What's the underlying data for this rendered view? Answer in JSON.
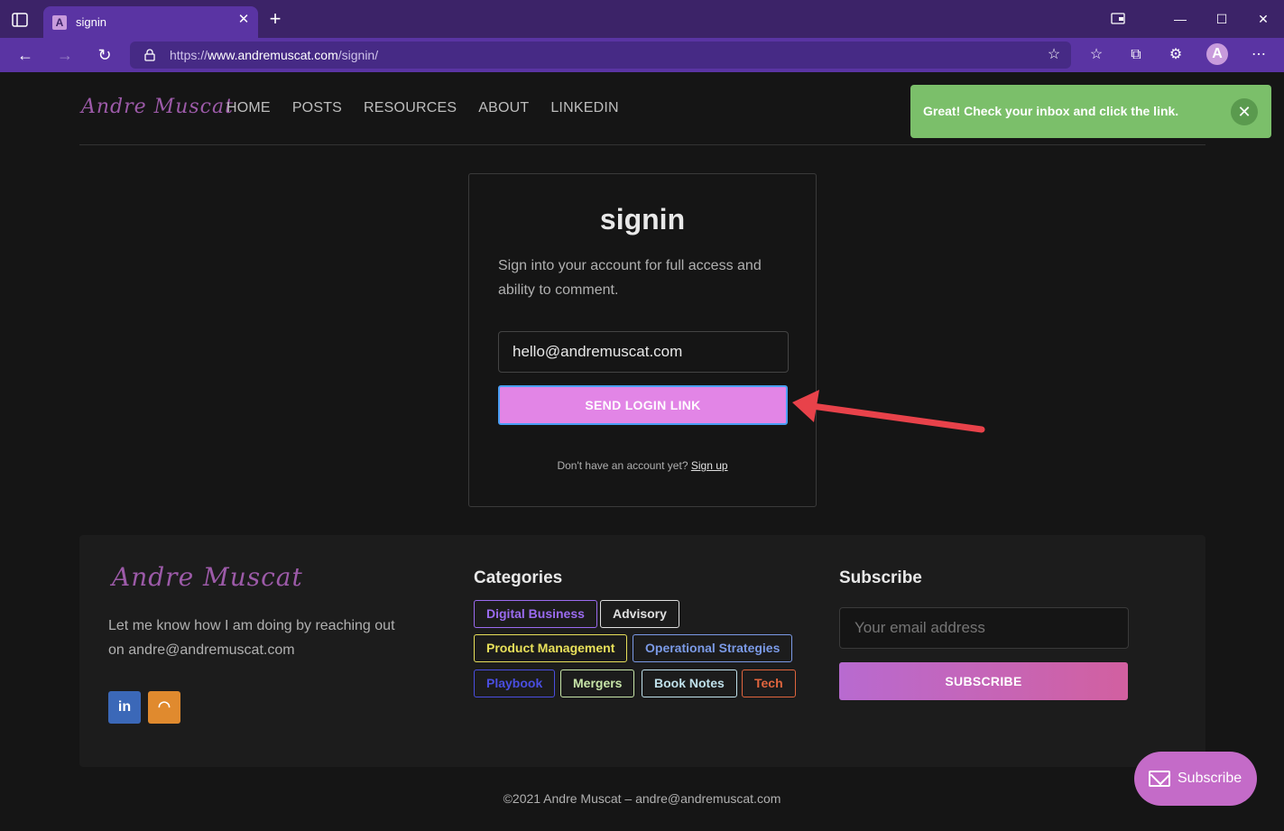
{
  "browser": {
    "tab_title": "signin",
    "tab_favicon": "A",
    "url_prefix": "https://",
    "url_domain": "www.andremuscat.com",
    "url_path": "/signin/",
    "profile_initial": "A"
  },
  "header": {
    "logo": "Andre Muscat",
    "nav": [
      "HOME",
      "POSTS",
      "RESOURCES",
      "ABOUT",
      "LINKEDIN"
    ]
  },
  "toast": {
    "message": "Great! Check your inbox and click the link.",
    "close": "✕"
  },
  "signin": {
    "title": "signin",
    "description": "Sign into your account for full access and ability to comment.",
    "email_value": "hello@andremuscat.com",
    "button_label": "SEND LOGIN LINK",
    "no_account_text": "Don't have an account yet?",
    "signup_link": "Sign up"
  },
  "footer": {
    "logo": "Andre Muscat",
    "text": "Let me know how I am doing by reaching out on andre@andremuscat.com",
    "social_linkedin": "in",
    "social_rss": "◠",
    "categories_title": "Categories",
    "categories": [
      {
        "label": "Digital Business",
        "color": "#9b6bf0"
      },
      {
        "label": "Advisory",
        "color": "#e0e0e0"
      },
      {
        "label": "Product Management",
        "color": "#e8e05a"
      },
      {
        "label": "Operational Strategies",
        "color": "#7b9ae6"
      },
      {
        "label": "Playbook",
        "color": "#4a4ee0"
      },
      {
        "label": "Mergers",
        "color": "#c7e5a8"
      },
      {
        "label": "Book Notes",
        "color": "#bfe0ea"
      },
      {
        "label": "Tech",
        "color": "#e0653e"
      }
    ],
    "subscribe_title": "Subscribe",
    "subscribe_placeholder": "Your email address",
    "subscribe_button": "SUBSCRIBE"
  },
  "copyright": "©2021 Andre Muscat – andre@andremuscat.com",
  "floating_subscribe": "Subscribe",
  "colors": {
    "accent_pink": "#e285e6",
    "toast_green": "#7bbf6a",
    "browser_purple": "#5a34a3",
    "arrow_red": "#e8424a"
  }
}
